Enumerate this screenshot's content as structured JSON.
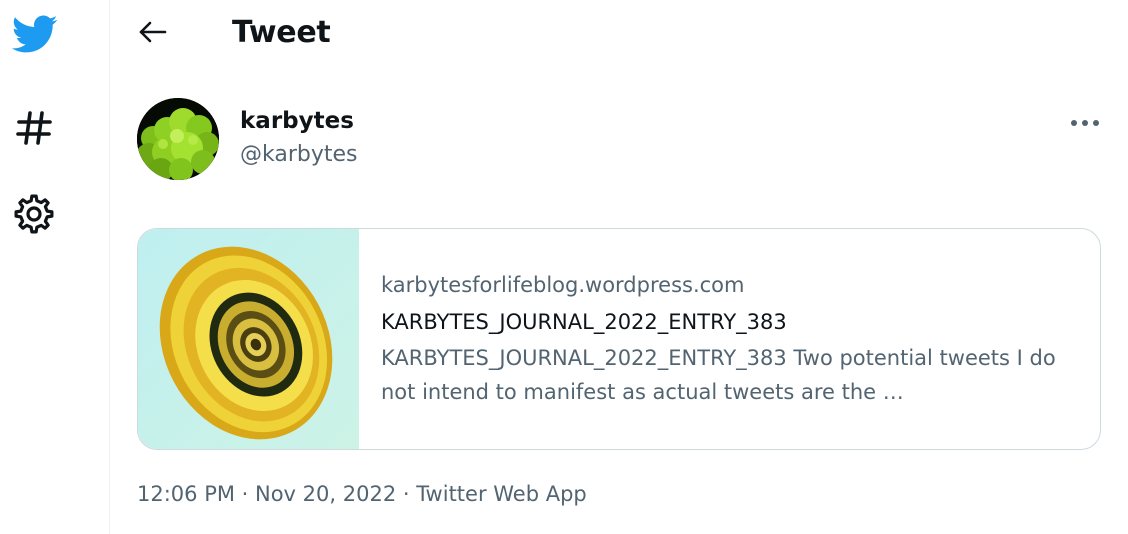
{
  "sidebar": {
    "icons": [
      "twitter-bird-icon",
      "hashtag-icon",
      "gear-icon"
    ]
  },
  "header": {
    "title": "Tweet"
  },
  "tweet": {
    "author_name": "karbytes",
    "author_handle": "@karbytes",
    "card": {
      "domain": "karbytesforlifeblog.wordpress.com",
      "title": "KARBYTES_JOURNAL_2022_ENTRY_383",
      "description": "KARBYTES_JOURNAL_2022_ENTRY_383 Two potential tweets I do not intend to manifest as actual tweets are the …"
    },
    "timestamp": "12:06 PM · Nov 20, 2022 · Twitter Web App"
  },
  "colors": {
    "brand": "#1d9bf0",
    "text": "#0f1419",
    "muted": "#536471",
    "border": "#cfd9de"
  }
}
